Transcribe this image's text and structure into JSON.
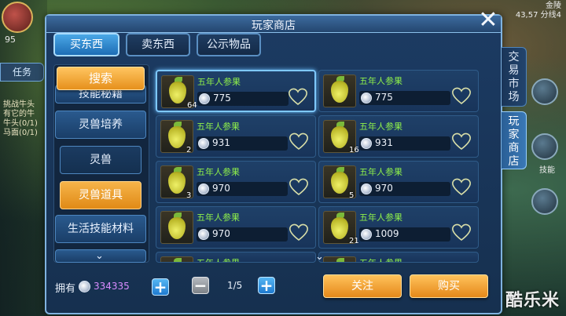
{
  "window_title": "玩家商店",
  "tabs": [
    {
      "label": "买东西",
      "active": true
    },
    {
      "label": "卖东西",
      "active": false
    },
    {
      "label": "公示物品",
      "active": false
    }
  ],
  "side_tabs": [
    {
      "label": "交易市场",
      "active": false
    },
    {
      "label": "玩家商店",
      "active": true
    }
  ],
  "search_label": "搜索",
  "categories": [
    {
      "label": "技能秘籍",
      "kind": "main",
      "selected": false
    },
    {
      "label": "灵兽培养",
      "kind": "main",
      "selected": false
    },
    {
      "label": "灵兽",
      "kind": "sub",
      "selected": false
    },
    {
      "label": "灵兽道具",
      "kind": "sub",
      "selected": true
    },
    {
      "label": "生活技能材料",
      "kind": "main",
      "selected": false
    }
  ],
  "items": [
    {
      "name": "五年人参果",
      "qty": "64",
      "price": "775",
      "selected": true
    },
    {
      "name": "五年人参果",
      "qty": "",
      "price": "775",
      "selected": false
    },
    {
      "name": "五年人参果",
      "qty": "2",
      "price": "931",
      "selected": false
    },
    {
      "name": "五年人参果",
      "qty": "16",
      "price": "931",
      "selected": false
    },
    {
      "name": "五年人参果",
      "qty": "3",
      "price": "970",
      "selected": false
    },
    {
      "name": "五年人参果",
      "qty": "5",
      "price": "970",
      "selected": false
    },
    {
      "name": "五年人参果",
      "qty": "",
      "price": "970",
      "selected": false
    },
    {
      "name": "五年人参果",
      "qty": "21",
      "price": "1009",
      "selected": false
    },
    {
      "name": "五年人参果",
      "qty": "",
      "price": "",
      "selected": false
    },
    {
      "name": "五年人参果",
      "qty": "",
      "price": "",
      "selected": false
    }
  ],
  "footer": {
    "own_label": "拥有",
    "own_value": "334335",
    "plus_left": "+",
    "minus": "−",
    "page": "1/5",
    "plus_right": "+",
    "follow_label": "关注",
    "buy_label": "购买"
  },
  "hud": {
    "level": "95",
    "task": "任务",
    "lines": [
      "挑战牛头",
      "有它的牛",
      "牛头(0/1)",
      "马面(0/1)"
    ],
    "right_top": [
      "金陵",
      "43,57 分线4"
    ],
    "right_label": "技能"
  },
  "watermark": "酷乐米",
  "colors": {
    "accent_orange": "#e6901c",
    "accent_blue": "#1f7ad0",
    "item_name_green": "#8ff04a",
    "own_value_purple": "#d98cff"
  }
}
